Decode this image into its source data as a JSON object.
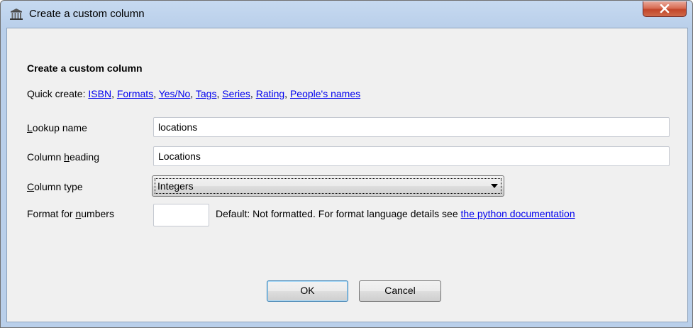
{
  "window": {
    "title": "Create a custom column",
    "icon": "library-icon"
  },
  "dialog": {
    "heading": "Create a custom column",
    "quick_create": {
      "label": "Quick create: ",
      "links": [
        "ISBN",
        "Formats",
        "Yes/No",
        "Tags",
        "Series",
        "Rating",
        "People's names"
      ]
    },
    "lookup_name": {
      "label_first": "L",
      "label_rest": "ookup name",
      "value": "locations"
    },
    "column_heading": {
      "label_pre": "Column ",
      "label_u": "h",
      "label_post": "eading",
      "value": "Locations"
    },
    "column_type": {
      "label_first": "C",
      "label_rest": "olumn type",
      "selected": "Integers"
    },
    "format_numbers": {
      "label_pre": "Format for ",
      "label_u": "n",
      "label_post": "umbers",
      "value": "",
      "hint_text": "Default: Not formatted. For format language details see ",
      "hint_link": "the python documentation"
    },
    "buttons": {
      "ok": "OK",
      "cancel": "Cancel"
    }
  }
}
